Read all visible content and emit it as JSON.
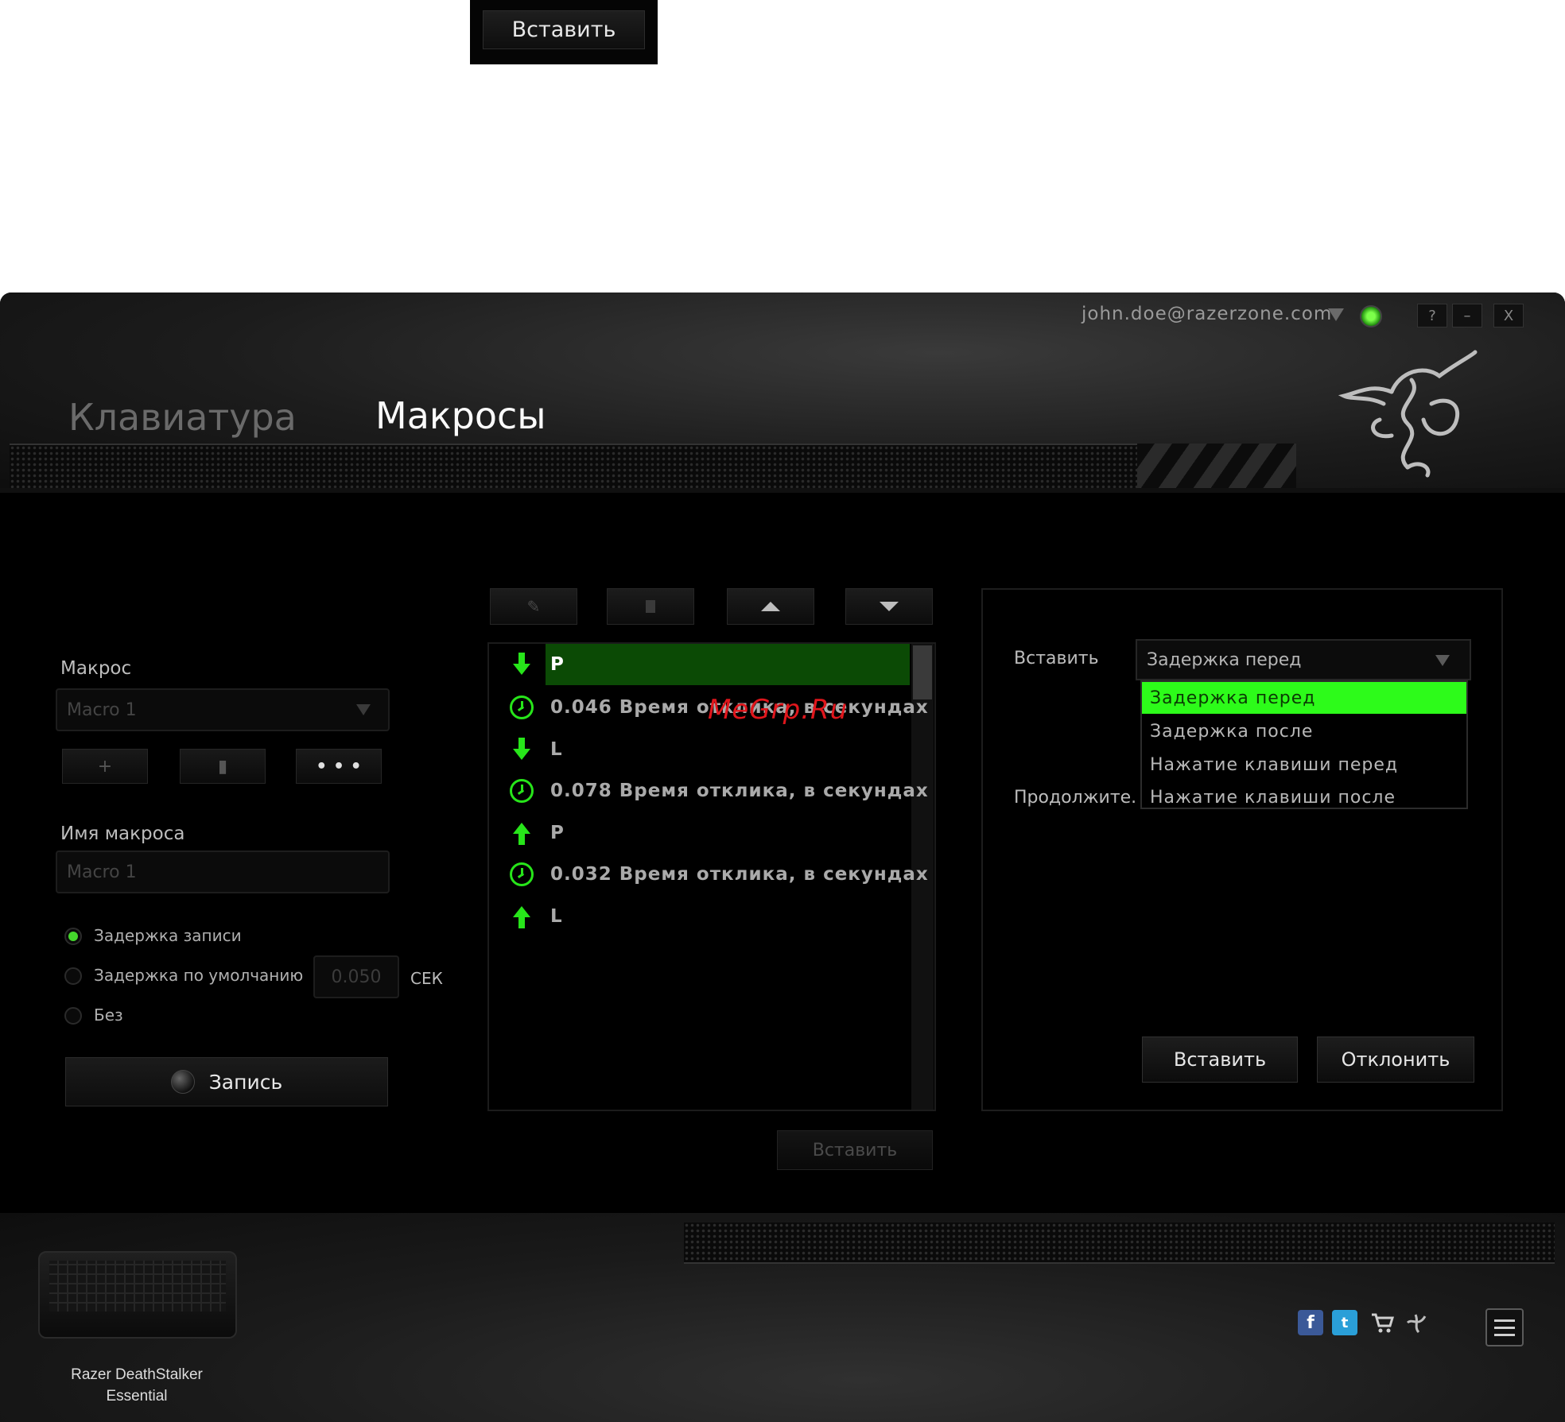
{
  "top_button": {
    "label": "Вставить"
  },
  "header": {
    "account_email": "john.doe@razerzone.com",
    "window_buttons": [
      "?",
      "–",
      "X"
    ],
    "tabs": [
      {
        "label": "Клавиатура",
        "active": false
      },
      {
        "label": "Макросы",
        "active": true
      }
    ]
  },
  "left_panel": {
    "macro_label": "Макрос",
    "macro_select_value": "Macro 1",
    "macro_buttons": [
      "+",
      "▮",
      "• • •"
    ],
    "macro_name_label": "Имя макроса",
    "macro_name_value": "Macro 1",
    "delay_options": [
      {
        "label": "Задержка записи",
        "selected": true
      },
      {
        "label": "Задержка по умолчанию",
        "selected": false
      },
      {
        "label": "Без",
        "selected": false
      }
    ],
    "default_delay_value": "0.050",
    "delay_unit": "СЕК",
    "record_label": "Запись"
  },
  "event_list": {
    "rows": [
      {
        "icon": "key-down-arrow-icon",
        "text": "P",
        "selected": true
      },
      {
        "icon": "clock-icon",
        "text": "0.046 Время отклика, в секундах",
        "selected": false
      },
      {
        "icon": "key-down-arrow-icon",
        "text": "L",
        "selected": false
      },
      {
        "icon": "clock-icon",
        "text": "0.078 Время отклика, в секундах",
        "selected": false
      },
      {
        "icon": "key-up-arrow-icon",
        "text": "P",
        "selected": false
      },
      {
        "icon": "clock-icon",
        "text": "0.032 Время отклика, в секундах",
        "selected": false
      },
      {
        "icon": "key-up-arrow-icon",
        "text": "L",
        "selected": false
      }
    ],
    "insert_label": "Вставить"
  },
  "watermark": "MeGrp.Ru",
  "right_panel": {
    "insert_label": "Вставить",
    "selected_value": "Задержка перед",
    "continue_label": "Продолжите.",
    "options": [
      "Задержка перед",
      "Задержка после",
      "Нажатие клавиши перед",
      "Нажатие клавиши после"
    ],
    "insert_button": "Вставить",
    "cancel_button": "Отклонить"
  },
  "footer": {
    "device_name_line1": "Razer DeathStalker",
    "device_name_line2": "Essential"
  },
  "colors": {
    "accent_green": "#44d62c",
    "highlight_green": "#2dfb1a",
    "selected_row": "#0b4a05"
  }
}
